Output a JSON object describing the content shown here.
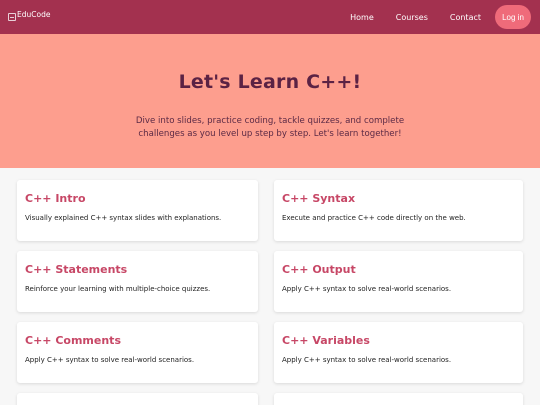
{
  "navbar": {
    "logo_text": "EduCode",
    "links": [
      "Home",
      "Courses",
      "Contact"
    ],
    "login_label": "Log in"
  },
  "hero": {
    "title": "Let's Learn C++!",
    "subtitle": "Dive into slides, practice coding, tackle quizzes, and complete challenges as you level up step by step. Let's learn together!"
  },
  "cards": [
    {
      "title": "C++ Intro",
      "desc": "Visually explained C++ syntax slides with explanations."
    },
    {
      "title": "C++ Syntax",
      "desc": "Execute and practice C++ code directly on the web."
    },
    {
      "title": "C++ Statements",
      "desc": "Reinforce your learning with multiple-choice quizzes."
    },
    {
      "title": "C++ Output",
      "desc": "Apply C++ syntax to solve real-world scenarios."
    },
    {
      "title": "C++ Comments",
      "desc": "Apply C++ syntax to solve real-world scenarios."
    },
    {
      "title": "C++ Variables",
      "desc": "Apply C++ syntax to solve real-world scenarios."
    }
  ],
  "colors": {
    "navbar": "#a3314f",
    "hero_bg": "#fd9e8e",
    "accent": "#c74766",
    "login_bg": "#ef6b7a"
  }
}
